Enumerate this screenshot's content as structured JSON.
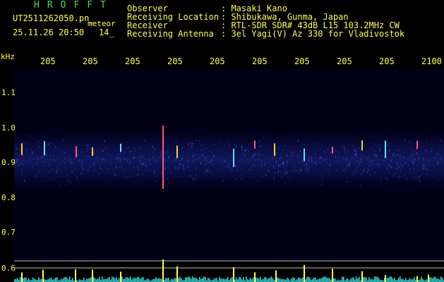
{
  "header": {
    "program_logo": "HROFFT",
    "file_name": "UT2511262050.pn_",
    "meteor_tag": "meteor",
    "datetime": "25.11.26 20:50",
    "count": "14_",
    "fields": [
      {
        "label": "Observer",
        "value": ": Masaki Kano"
      },
      {
        "label": "Receiving Location",
        "value": ": Shibukawa, Gunma, Japan"
      },
      {
        "label": "Receiver",
        "value": ": RTL-SDR SDR# 43dB L15 103.2MHz CW"
      },
      {
        "label": "Receiving Antenna",
        "value": ": 3el Yagi(V) Az 330 for Vladivostok"
      }
    ]
  },
  "axes": {
    "y_unit": "kHz",
    "x_tick_labels": [
      "205",
      "205",
      "205",
      "205",
      "205",
      "205",
      "205",
      "205",
      "205",
      "2100"
    ],
    "y_tick_labels": [
      "1.1",
      "1.0",
      "0.9",
      "0.8",
      "0.7",
      "0.6"
    ]
  },
  "colors": {
    "text_yellow": "#ffff55",
    "logo_green": "#44dd55",
    "background": "#000000",
    "waterfall_bg": "#000018",
    "signal_trace": "#33dddd"
  }
}
